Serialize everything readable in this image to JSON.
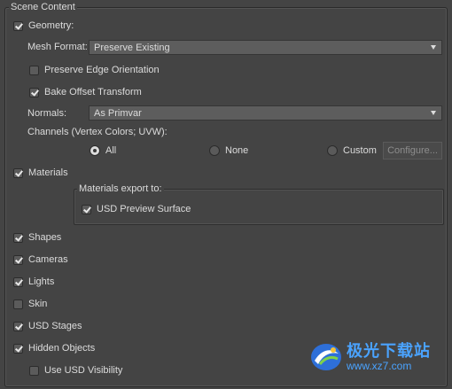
{
  "panel": {
    "title": "Scene Content",
    "geometry": {
      "label": "Geometry:",
      "checked": true,
      "mesh_format": {
        "label": "Mesh Format:",
        "value": "Preserve Existing"
      },
      "preserve_edge": {
        "label": "Preserve Edge Orientation",
        "checked": false
      },
      "bake_offset": {
        "label": "Bake Offset Transform",
        "checked": true
      },
      "normals": {
        "label": "Normals:",
        "value": "As Primvar"
      },
      "channels": {
        "label": "Channels (Vertex Colors; UVW):",
        "options": [
          "All",
          "None",
          "Custom"
        ],
        "selected": "All",
        "configure_label": "Configure..."
      }
    },
    "materials": {
      "label": "Materials",
      "checked": true,
      "export_to": {
        "label": "Materials export to:",
        "usd_preview": {
          "label": "USD Preview Surface",
          "checked": true
        }
      }
    },
    "shapes": {
      "label": "Shapes",
      "checked": true
    },
    "cameras": {
      "label": "Cameras",
      "checked": true
    },
    "lights": {
      "label": "Lights",
      "checked": true
    },
    "skin": {
      "label": "Skin",
      "checked": false
    },
    "usd_stages": {
      "label": "USD Stages",
      "checked": true
    },
    "hidden_objects": {
      "label": "Hidden Objects",
      "checked": true,
      "use_usd_visibility": {
        "label": "Use USD Visibility",
        "checked": false
      }
    }
  },
  "watermark": {
    "text_cn": "极光下载站",
    "url": "www.xz7.com",
    "accent": "#4aa3ff"
  },
  "colors": {
    "background": "#444444",
    "control": "#5d5d5d",
    "text": "#dcdcdc"
  }
}
